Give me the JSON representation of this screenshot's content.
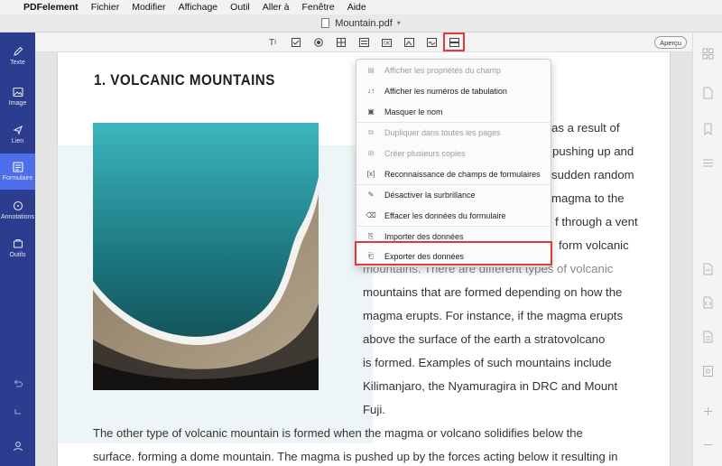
{
  "menubar": {
    "items": [
      {
        "label": "PDFelement"
      },
      {
        "label": "Fichier"
      },
      {
        "label": "Modifier"
      },
      {
        "label": "Affichage"
      },
      {
        "label": "Outil"
      },
      {
        "label": "Aller à"
      },
      {
        "label": "Fenêtre"
      },
      {
        "label": "Aide"
      }
    ]
  },
  "window": {
    "title": "Mountain.pdf"
  },
  "sidebar": {
    "items": [
      {
        "label": "Texte"
      },
      {
        "label": "Image"
      },
      {
        "label": "Lien"
      },
      {
        "label": "Formulaire"
      },
      {
        "label": "Annotations"
      },
      {
        "label": "Outils"
      }
    ],
    "active": "Formulaire"
  },
  "toolbar": {
    "preview_label": "Aperçu"
  },
  "document": {
    "heading": "1. VOLCANIC MOUNTAINS",
    "lines": [
      "as a result of",
      "pushing up and",
      "sudden random",
      "magma to the",
      "f through a vent",
      "form volcanic",
      "mountains. There are different types of volcanic",
      "mountains that are formed depending on how the",
      "magma erupts. For instance, if the magma erupts",
      "above the surface of the earth a stratovolcano",
      "is formed. Examples of such mountains include",
      "Kilimanjaro, the Nyamuragira in DRC and Mount",
      "Fuji.",
      "The other type of volcanic mountain is formed when the magma or volcano solidifies below the",
      "surface. forming a dome mountain. The magma is pushed up by the forces acting below it resulting in"
    ]
  },
  "dropdown": {
    "items": [
      {
        "label": "Afficher les propriétés du champ",
        "enabled": false
      },
      {
        "label": "Afficher les numéros de tabulation",
        "enabled": true
      },
      {
        "label": "Masquer le nom",
        "enabled": true
      },
      {
        "label": "Dupliquer dans toutes les pages",
        "enabled": false
      },
      {
        "label": "Créer plusieurs copies",
        "enabled": false
      },
      {
        "label": "Reconnaissance de champs de formulaires",
        "enabled": true
      },
      {
        "label": "Désactiver la surbrillance",
        "enabled": true
      },
      {
        "label": "Effacer les données du formulaire",
        "enabled": true
      },
      {
        "label": "Importer des données",
        "enabled": true
      },
      {
        "label": "Exporter des données",
        "enabled": true,
        "highlighted": true
      }
    ]
  },
  "colors": {
    "sidebar": "#2c3c8e",
    "sidebar_active": "#4d6ee8",
    "highlight": "#e03a3a"
  }
}
